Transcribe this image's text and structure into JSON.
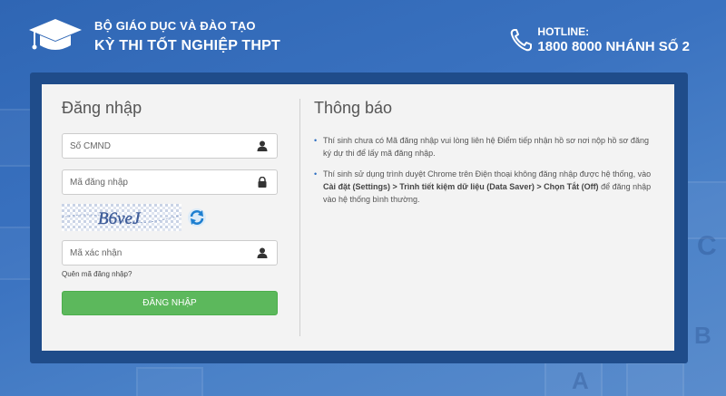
{
  "header": {
    "org_line1": "BỘ GIÁO DỤC VÀ ĐÀO TẠO",
    "org_line2": "KỲ THI TỐT NGHIỆP THPT",
    "hotline_label": "HOTLINE:",
    "hotline_number": "1800 8000 NHÁNH SỐ 2"
  },
  "login": {
    "title": "Đăng nhập",
    "id_placeholder": "Số CMND",
    "code_placeholder": "Mã đăng nhập",
    "captcha_text": "B6veJ",
    "verify_placeholder": "Mã xác nhận",
    "forgot_label": "Quên mã đăng nhập?",
    "submit_label": "ĐĂNG NHẬP"
  },
  "notice": {
    "title": "Thông báo",
    "item1": "Thí sinh chưa có Mã đăng nhập vui lòng liên hệ Điểm tiếp nhận hồ sơ nơi nộp hồ sơ đăng ký dự thi để lấy mã đăng nhập.",
    "item2_prefix": "Thí sinh sử dụng trình duyệt Chrome trên Điện thoại không đăng nhập được hệ thống, vào ",
    "item2_bold": "Cài đặt (Settings) > Trình tiết kiệm dữ liệu (Data Saver) > Chọn Tắt (Off)",
    "item2_suffix": " để đăng nhập vào hệ thống bình thường.",
    "bullet": "•"
  },
  "colors": {
    "background": "#3a72c0",
    "frame": "#1f4c8a",
    "button": "#5cb85c",
    "bullet": "#2a6cc0"
  },
  "icons": [
    "graduation-cap-icon",
    "phone-icon",
    "user-icon",
    "lock-icon",
    "refresh-icon"
  ]
}
